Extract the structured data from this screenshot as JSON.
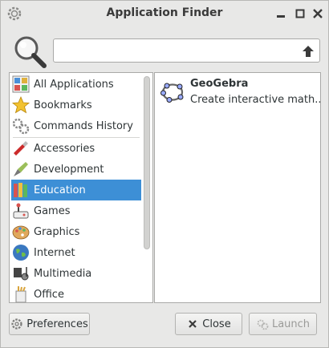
{
  "window": {
    "title": "Application Finder"
  },
  "search": {
    "value": "",
    "placeholder": ""
  },
  "categories": [
    {
      "label": "All Applications",
      "icon": "all-apps-icon"
    },
    {
      "label": "Bookmarks",
      "icon": "star-icon"
    },
    {
      "label": "Commands History",
      "icon": "gears-icon"
    },
    {
      "label": "Accessories",
      "icon": "accessories-icon"
    },
    {
      "label": "Development",
      "icon": "development-icon"
    },
    {
      "label": "Education",
      "icon": "education-icon",
      "selected": true
    },
    {
      "label": "Games",
      "icon": "games-icon"
    },
    {
      "label": "Graphics",
      "icon": "graphics-icon"
    },
    {
      "label": "Internet",
      "icon": "globe-icon"
    },
    {
      "label": "Multimedia",
      "icon": "multimedia-icon"
    },
    {
      "label": "Office",
      "icon": "office-icon"
    }
  ],
  "results": [
    {
      "name": "GeoGebra",
      "description": "Create interactive math...",
      "icon": "geogebra-icon"
    }
  ],
  "buttons": {
    "preferences": "Preferences",
    "close": "Close",
    "launch": "Launch"
  },
  "colors": {
    "selection": "#3d8fd6",
    "window_bg": "#e8e8e7"
  }
}
